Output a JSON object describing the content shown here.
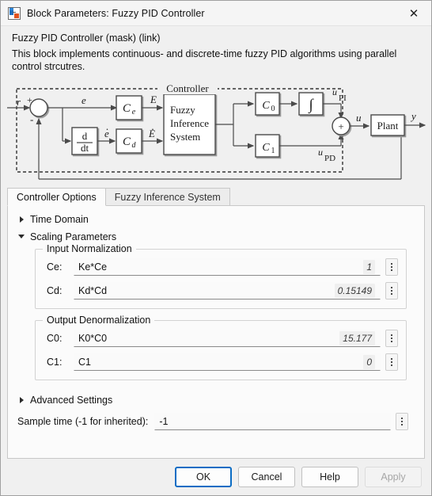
{
  "window": {
    "title": "Block Parameters: Fuzzy PID Controller",
    "icon": "simulink-block-icon",
    "close_label": "✕"
  },
  "mask": {
    "header": "Fuzzy PID Controller (mask) (link)",
    "description": "This block implements continuous- and discrete-time fuzzy PID algorithms using parallel control strcutres."
  },
  "diagram": {
    "title": "Controller",
    "labels": {
      "r": "r",
      "plus": "+",
      "minus": "-",
      "e": "e",
      "edot": "ė",
      "E": "E",
      "Edot": "Ė",
      "u": "u",
      "y": "y",
      "u_pi_base": "u",
      "u_pi_sub": "PI",
      "u_pd_base": "u",
      "u_pd_sub": "PD",
      "sum_plus": "+"
    },
    "blocks": {
      "ce": "C",
      "ce_sub": "e",
      "cd": "C",
      "cd_sub": "d",
      "deriv_num": "d",
      "deriv_den": "dt",
      "fis_line1": "Fuzzy",
      "fis_line2": "Inference",
      "fis_line3": "System",
      "c0": "C",
      "c0_sub": "0",
      "c1": "C",
      "c1_sub": "1",
      "integrator": "∫",
      "plant": "Plant"
    }
  },
  "tabs": [
    {
      "label": "Controller Options",
      "active": true
    },
    {
      "label": "Fuzzy Inference System",
      "active": false
    }
  ],
  "sections": {
    "time_domain": {
      "label": "Time Domain",
      "expanded": false
    },
    "scaling_parameters": {
      "label": "Scaling Parameters",
      "expanded": true
    },
    "advanced_settings": {
      "label": "Advanced Settings",
      "expanded": false
    }
  },
  "input_normalization": {
    "title": "Input Normalization",
    "fields": [
      {
        "label": "Ce:",
        "value": "Ke*Ce",
        "evaluated": "1"
      },
      {
        "label": "Cd:",
        "value": "Kd*Cd",
        "evaluated": "0.15149"
      }
    ]
  },
  "output_denormalization": {
    "title": "Output Denormalization",
    "fields": [
      {
        "label": "C0:",
        "value": "K0*C0",
        "evaluated": "15.177"
      },
      {
        "label": "C1:",
        "value": "C1",
        "evaluated": "0"
      }
    ]
  },
  "sample_time": {
    "label": "Sample time (-1 for inherited):",
    "value": "-1"
  },
  "footer": {
    "ok": "OK",
    "cancel": "Cancel",
    "help": "Help",
    "apply": "Apply"
  },
  "colors": {
    "accent": "#0a6cc4",
    "window_bg": "#f0f0f0",
    "panel_bg": "#fbfbfb",
    "border": "#c8c8c8",
    "disabled_text": "#a6a6a6"
  }
}
